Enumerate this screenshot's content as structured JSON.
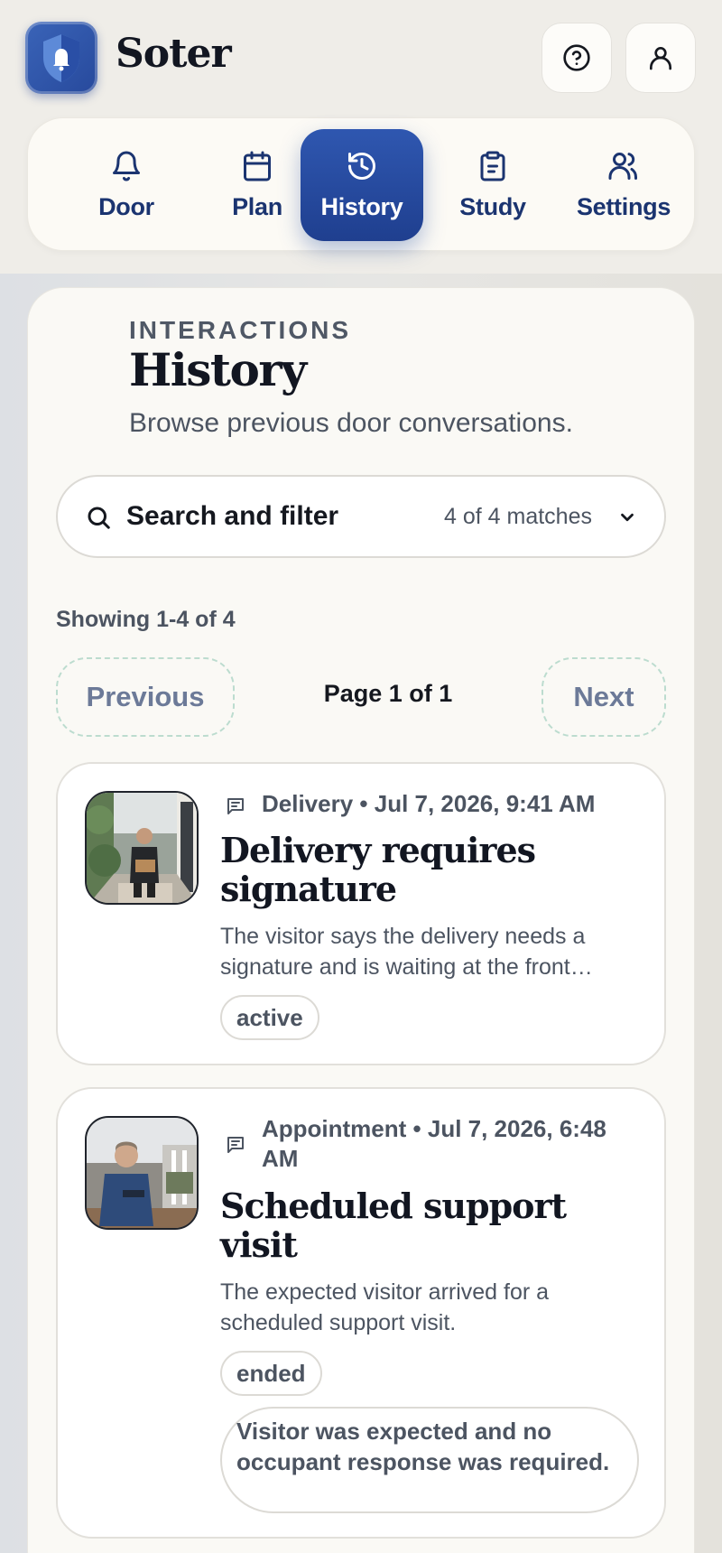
{
  "app": {
    "brand": "Soter",
    "logo_icon": "bell-shield-icon",
    "help_icon": "help-circle-icon",
    "account_icon": "user-icon"
  },
  "nav": {
    "items": [
      {
        "label": "Door",
        "icon": "bell-icon"
      },
      {
        "label": "Plan",
        "icon": "calendar-icon"
      },
      {
        "label": "History",
        "icon": "history-icon",
        "active": true
      },
      {
        "label": "Study",
        "icon": "clipboard-icon"
      },
      {
        "label": "Settings",
        "icon": "users-icon"
      }
    ]
  },
  "header": {
    "eyebrow": "INTERACTIONS",
    "title": "History",
    "subtitle": "Browse previous door conversations."
  },
  "search": {
    "label": "Search and filter",
    "match_count": "4 of 4 matches"
  },
  "pagination": {
    "showing": "Showing 1-4 of 4",
    "previous": "Previous",
    "page": "Page 1 of 1",
    "next": "Next"
  },
  "interactions": [
    {
      "meta": "Delivery • Jul 7, 2026, 9:41 AM",
      "title": "Delivery requires signature",
      "description": "The visitor says the delivery needs a signature and is waiting at the front…",
      "status": "active",
      "icon": "message-icon"
    },
    {
      "meta": "Appointment • Jul 7, 2026, 6:48 AM",
      "title": "Scheduled support visit",
      "description": "The expected visitor arrived for a scheduled support visit.",
      "status": "ended",
      "note": "Visitor was expected and no occupant response was required.",
      "icon": "message-icon"
    }
  ],
  "colors": {
    "accent": "#27499c",
    "nav_text": "#1b3470",
    "muted_text": "#4c5461",
    "pager_border": "#bcdccf"
  }
}
